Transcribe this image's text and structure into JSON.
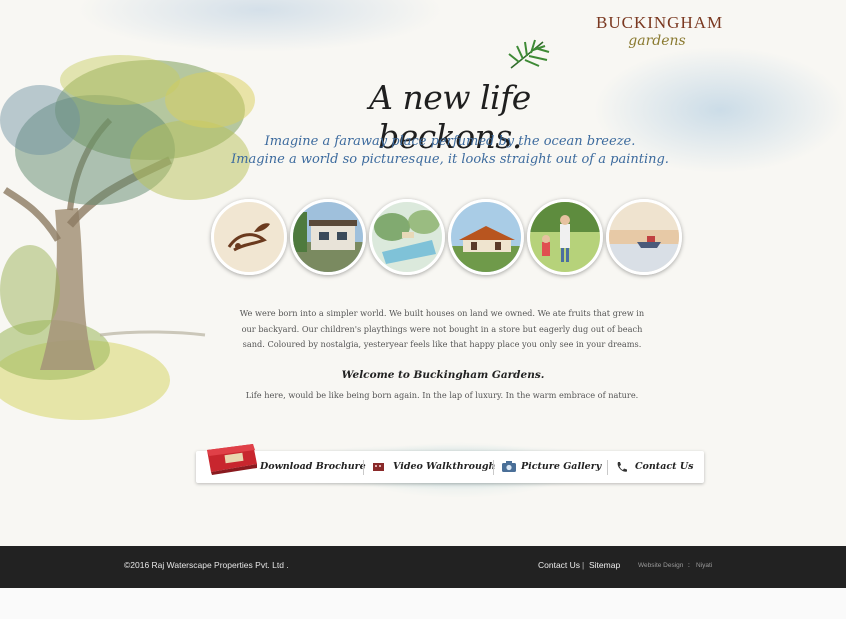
{
  "logo": {
    "title": "BUCKINGHAM",
    "subtitle": "gardens"
  },
  "hero": {
    "headline": "A new life beckons.",
    "tagline_1": "Imagine a faraway place perfumed by the ocean breeze.",
    "tagline_2": "Imagine a world so picturesque, it looks straight out of a painting."
  },
  "intro": {
    "paragraph": "We were born into a simpler world. We built houses on land we owned. We ate fruits that grew in our backyard. Our children's playthings were not bought in a store but eagerly dug out of beach sand. Coloured by nostalgia, yesteryear feels like that happy place you only see in your dreams.",
    "welcome": "Welcome to Buckingham Gardens.",
    "life": "Life here, would be like being born again. In the lap of luxury. In the warm embrace of nature."
  },
  "nav": {
    "brochure": "Download Brochure",
    "video": "Video Walkthrough",
    "gallery": "Picture Gallery",
    "contact": "Contact Us"
  },
  "footer": {
    "copyright": "©2016   Raj Waterscape Properties Pvt. Ltd .",
    "contact": "Contact Us",
    "separator": "|",
    "sitemap": "Sitemap",
    "credit_label": "Website Design",
    "credit_colon": ":",
    "credit_name": "Niyati"
  },
  "colors": {
    "logo_brown": "#7a3820",
    "tagline_blue": "#3d6b9e",
    "footer_bg": "#222222",
    "brochure_red": "#c8262e"
  }
}
